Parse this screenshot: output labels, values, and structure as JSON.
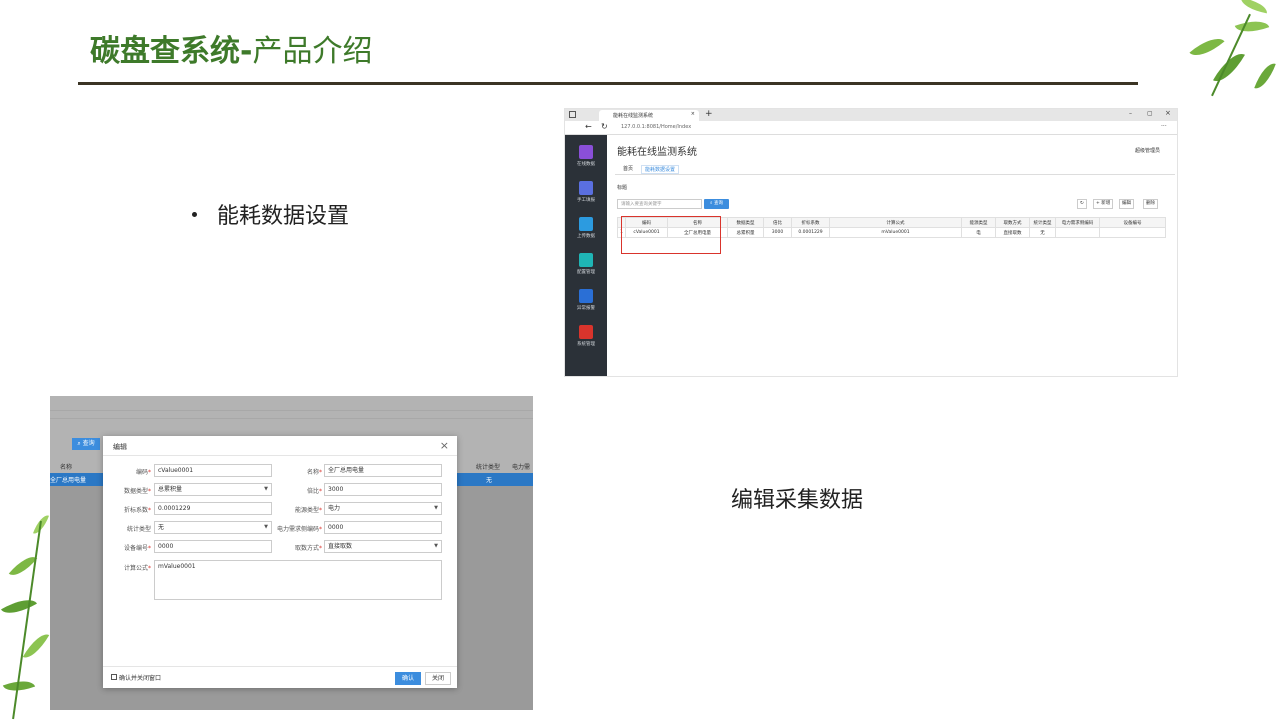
{
  "slide": {
    "title_bold": "碳盘查系统-",
    "title_light": "产品介绍",
    "bullet_1": "能耗数据设置",
    "caption_2": "编辑采集数据",
    "accent_color": "#3e7a2a"
  },
  "browser_shot": {
    "tab_title": "能耗在线监测系统",
    "url": "127.0.0.1:8081/Home/Index",
    "app_title": "能耗在线监测系统",
    "user": "超级管理员",
    "tabs": [
      "首页",
      "能耗数据设置"
    ],
    "panel_label": "标题",
    "search_placeholder": "请输入要查询关键字",
    "query_label": "查询",
    "toolbar": {
      "add": "+ 新增",
      "edit": "编辑",
      "delete": "删除"
    },
    "sidebar": [
      "在线数据",
      "手工填报",
      "上传数据",
      "配置管理",
      "异常报警",
      "系统管理"
    ],
    "table": {
      "columns": [
        "编码",
        "名称",
        "数据类型",
        "倍比",
        "折标系数",
        "计算公式",
        "能源类型",
        "取数方式",
        "统计类型",
        "电力需求侧编码",
        "设备编号"
      ],
      "rows": [
        {
          "index": "1",
          "cells": [
            "cValue0001",
            "全厂总用电量",
            "总累积量",
            "3000",
            "0.0001229",
            "mValue0001",
            "电",
            "直接取数",
            "无",
            "",
            ""
          ]
        }
      ]
    }
  },
  "dialog_shot": {
    "bg_query": "查询",
    "bg_col_name": "名称",
    "bg_row_name": "全厂总用电量",
    "bg_col_stat": "统计类型",
    "bg_col_power": "电力需",
    "bg_row_stat": "无",
    "dialog_title": "编辑",
    "fields": {
      "code_label": "编码",
      "code_value": "cValue0001",
      "name_label": "名称",
      "name_value": "全厂总用电量",
      "datatype_label": "数据类型",
      "datatype_value": "总累积量",
      "ratio_label": "倍比",
      "ratio_value": "3000",
      "factor_label": "折标系数",
      "factor_value": "0.0001229",
      "energy_label": "能源类型",
      "energy_value": "电力",
      "stat_label": "统计类型",
      "stat_value": "无",
      "power_label": "电力需求侧编码",
      "power_value": "0000",
      "device_label": "设备编号",
      "device_value": "0000",
      "fetch_label": "取数方式",
      "fetch_value": "直接取数",
      "formula_label": "计算公式",
      "formula_value": "mValue0001"
    },
    "confirm_close_label": "确认并关闭窗口",
    "ok_label": "确认",
    "close_label": "关闭"
  }
}
